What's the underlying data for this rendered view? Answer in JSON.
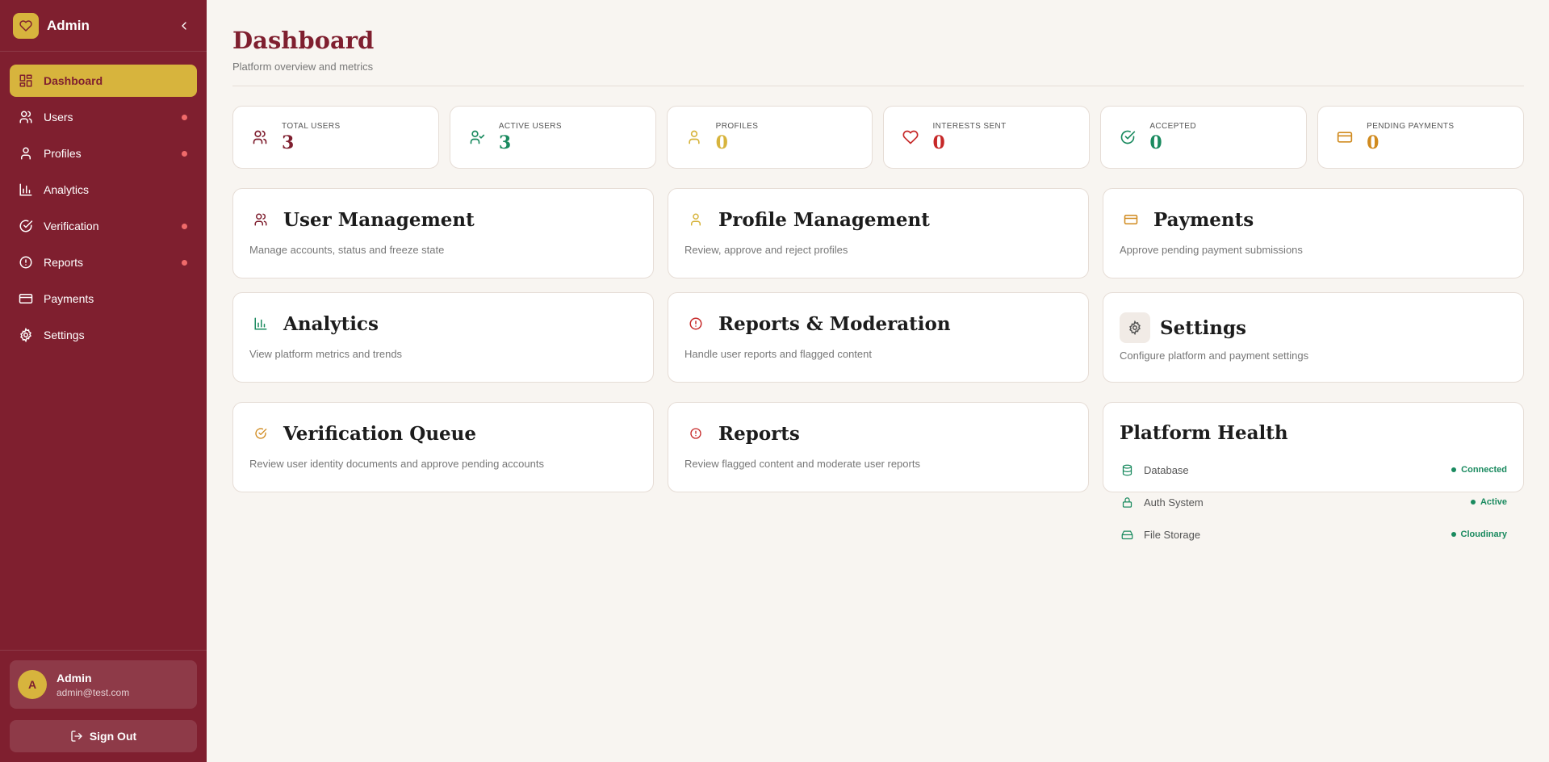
{
  "colors": {
    "sidebar": "#7f1f2f",
    "accent": "#d7b43d",
    "background": "#f8f5f1",
    "success": "#1a8a5f",
    "danger": "#c62828",
    "warning": "#d08a1e"
  },
  "sidebar": {
    "brand": "Admin",
    "items": [
      {
        "label": "Dashboard",
        "icon": "dashboard-icon",
        "active": true,
        "dot": false
      },
      {
        "label": "Users",
        "icon": "users-icon",
        "active": false,
        "dot": true
      },
      {
        "label": "Profiles",
        "icon": "user-icon",
        "active": false,
        "dot": true
      },
      {
        "label": "Analytics",
        "icon": "bar-chart-icon",
        "active": false,
        "dot": false
      },
      {
        "label": "Verification",
        "icon": "check-circle-icon",
        "active": false,
        "dot": true
      },
      {
        "label": "Reports",
        "icon": "alert-circle-icon",
        "active": false,
        "dot": true
      },
      {
        "label": "Payments",
        "icon": "credit-card-icon",
        "active": false,
        "dot": false
      },
      {
        "label": "Settings",
        "icon": "gear-icon",
        "active": false,
        "dot": false
      }
    ],
    "user": {
      "initial": "A",
      "name": "Admin",
      "email": "admin@test.com"
    },
    "signout_label": "Sign Out"
  },
  "header": {
    "title": "Dashboard",
    "subtitle": "Platform overview and metrics"
  },
  "stats": [
    {
      "label": "TOTAL USERS",
      "value": "3",
      "icon": "users-icon",
      "color": "#7f1f2f"
    },
    {
      "label": "ACTIVE USERS",
      "value": "3",
      "icon": "user-check-icon",
      "color": "#1a8a5f"
    },
    {
      "label": "PROFILES",
      "value": "0",
      "icon": "user-icon",
      "color": "#d7b43d"
    },
    {
      "label": "INTERESTS SENT",
      "value": "0",
      "icon": "heart-icon",
      "color": "#c62828"
    },
    {
      "label": "ACCEPTED",
      "value": "0",
      "icon": "check-circle-icon",
      "color": "#1a8a5f"
    },
    {
      "label": "PENDING PAYMENTS",
      "value": "0",
      "icon": "credit-card-icon",
      "color": "#d08a1e"
    }
  ],
  "cards": [
    {
      "title": "User Management",
      "desc": "Manage accounts, status and freeze state",
      "icon": "users-icon"
    },
    {
      "title": "Profile Management",
      "desc": "Review, approve and reject profiles",
      "icon": "user-icon"
    },
    {
      "title": "Payments",
      "desc": "Approve pending payment submissions",
      "icon": "credit-card-icon"
    },
    {
      "title": "Analytics",
      "desc": "View platform metrics and trends",
      "icon": "bar-chart-icon"
    },
    {
      "title": "Reports & Moderation",
      "desc": "Handle user reports and flagged content",
      "icon": "alert-circle-icon"
    },
    {
      "title": "Settings",
      "desc": "Configure platform and payment settings",
      "icon": "gear-icon"
    }
  ],
  "lower_cards": [
    {
      "title": "Verification Queue",
      "desc": "Review user identity documents and approve pending accounts",
      "icon": "check-circle-icon"
    },
    {
      "title": "Reports",
      "desc": "Review flagged content and moderate user reports",
      "icon": "alert-circle-icon"
    }
  ],
  "health": {
    "title": "Platform Health",
    "items": [
      {
        "name": "Database",
        "status": "Connected",
        "icon": "database-icon"
      },
      {
        "name": "Auth System",
        "status": "Active",
        "icon": "lock-icon"
      },
      {
        "name": "File Storage",
        "status": "Cloudinary",
        "icon": "hard-drive-icon"
      }
    ]
  }
}
